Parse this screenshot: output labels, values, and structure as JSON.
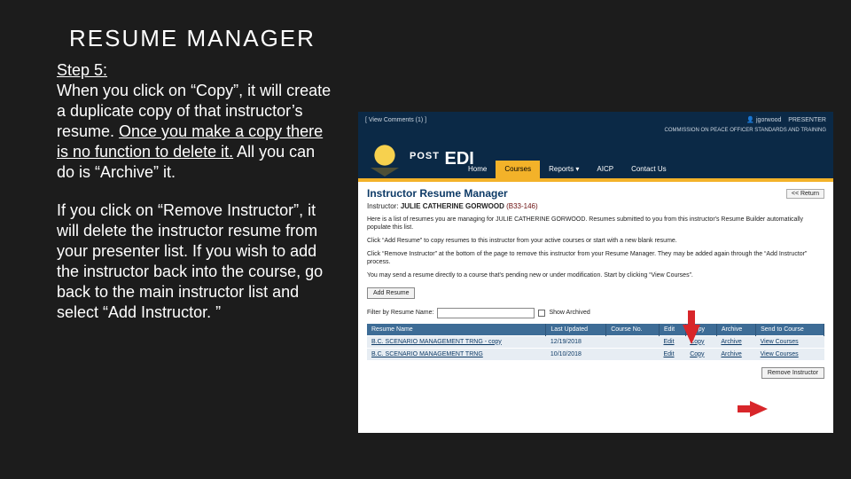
{
  "slide": {
    "title": "RESUME MANAGER",
    "step_label": "Step 5:",
    "para1_a": "When you click on “Copy”, it will create a duplicate copy of that instructor’s resume.  ",
    "para1_b": "Once you make a copy there is no function to delete it.",
    "para1_c": "  All you can do is “Archive” it.",
    "para2": "If you click on “Remove Instructor”, it will delete the instructor resume from your presenter list.  If you wish to add the instructor back into the course, go back to the main instructor list and select “Add Instructor. ”"
  },
  "app": {
    "topbar": {
      "left": "[ View Comments (1) ]",
      "user": "jgorwood",
      "role": "PRESENTER",
      "org": "COMMISSION ON PEACE OFFICER STANDARDS AND TRAINING"
    },
    "logo_small": "POST",
    "logo_big": "EDI",
    "nav": [
      "Home",
      "Courses",
      "Reports ▾",
      "AICP",
      "Contact Us"
    ],
    "nav_active_index": 1,
    "panel_title": "Instructor Resume Manager",
    "return_label": "<< Return",
    "instructor_label": "Instructor:",
    "instructor_name": "JULIE CATHERINE GORWOOD",
    "instructor_code": "(B33-146)",
    "p1": "Here is a list of resumes you are managing for JULIE CATHERINE GORWOOD. Resumes submitted to you from this instructor's Resume Builder automatically populate this list.",
    "p2": "Click “Add Resume” to copy resumes to this instructor from your active courses or start with a new blank resume.",
    "p3": "Click “Remove Instructor” at the bottom of the page to remove this instructor from your Resume Manager. They may be added again through the “Add Instructor” process.",
    "p4": "You may send a resume directly to a course that's pending new or under modification. Start by clicking “View Courses”.",
    "add_resume": "Add Resume",
    "filter_label": "Filter by Resume Name:",
    "show_archived": "Show Archived",
    "columns": [
      "Resume Name",
      "Last Updated",
      "Course No.",
      "Edit",
      "Copy",
      "Archive",
      "Send to Course"
    ],
    "rows": [
      {
        "name": "B.C. SCENARIO MANAGEMENT TRNG - copy",
        "date": "12/19/2018",
        "course": "",
        "edit": "Edit",
        "copy": "Copy",
        "archive": "Archive",
        "send": "View Courses"
      },
      {
        "name": "B.C. SCENARIO MANAGEMENT TRNG",
        "date": "10/10/2018",
        "course": "",
        "edit": "Edit",
        "copy": "Copy",
        "archive": "Archive",
        "send": "View Courses"
      }
    ],
    "remove_instructor": "Remove Instructor"
  }
}
